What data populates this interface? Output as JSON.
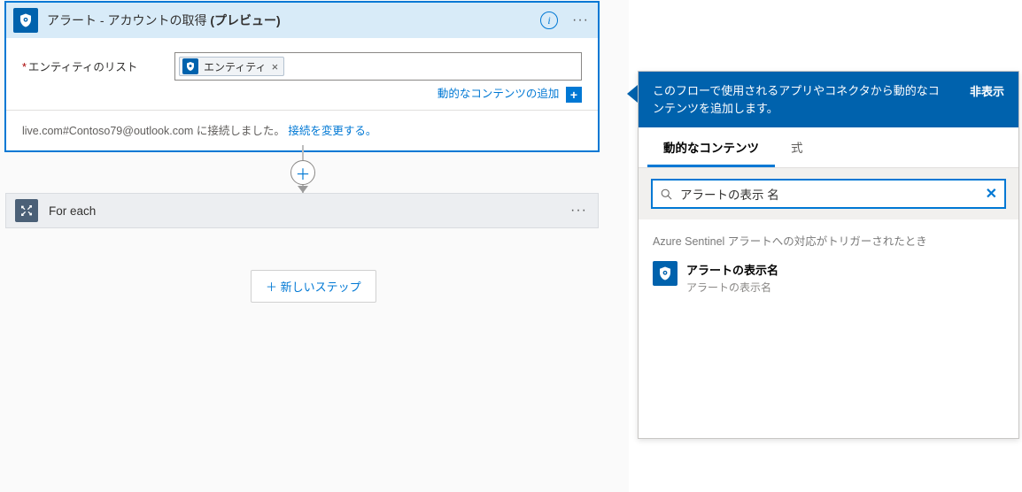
{
  "action": {
    "title_main": "アラート - アカウントの取得 ",
    "title_preview": "(プレビュー)",
    "field_label": "エンティティのリスト",
    "token_label": "エンティティ",
    "add_dynamic": "動的なコンテンツの追加",
    "connection_text": "live.com#Contoso79@outlook.com に接続しました。",
    "change_connection": "接続を変更する。"
  },
  "foreach": {
    "title": "For each"
  },
  "new_step": "＋ 新しいステップ",
  "panel": {
    "header_text": "このフローで使用されるアプリやコネクタから動的なコンテンツを追加します。",
    "hide": "非表示",
    "tab_dynamic": "動的なコンテンツ",
    "tab_expression": "式",
    "search_value": "アラートの表示 名",
    "section": "Azure Sentinel アラートへの対応がトリガーされたとき",
    "result_title": "アラートの表示名",
    "result_desc": "アラートの表示名"
  }
}
